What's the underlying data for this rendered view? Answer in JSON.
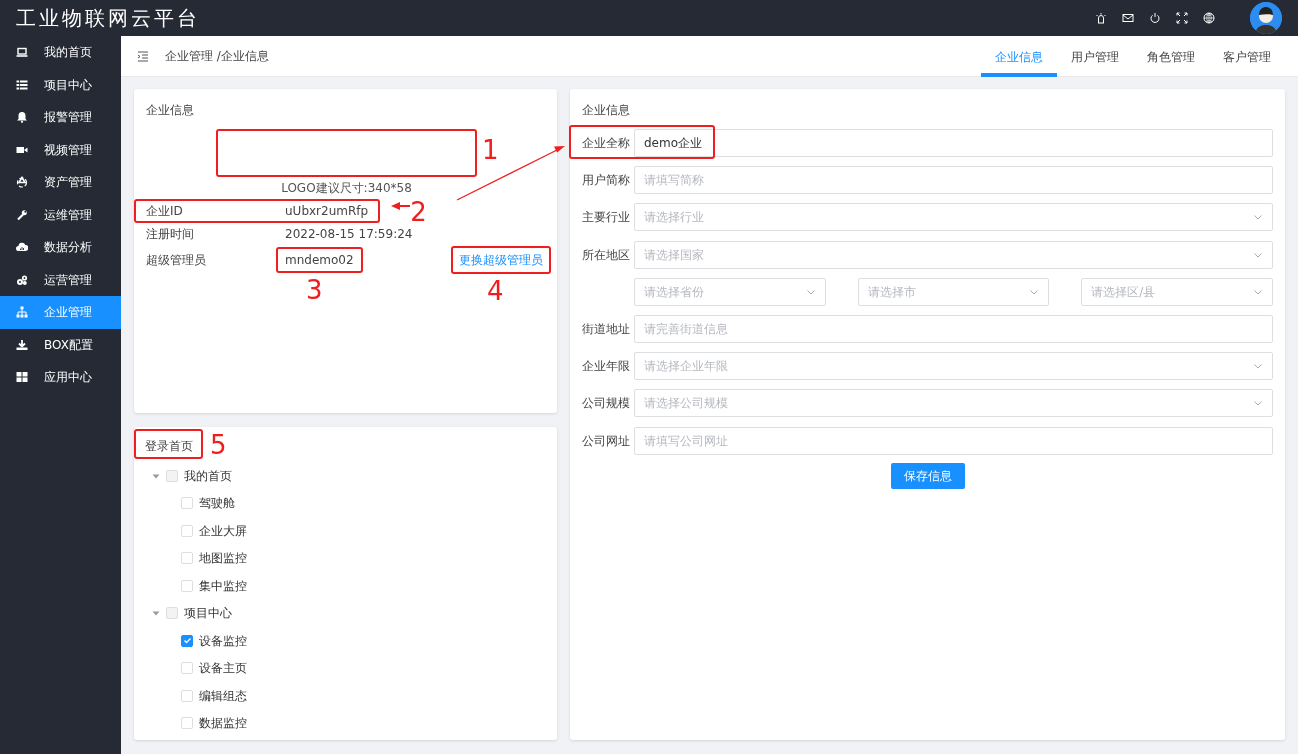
{
  "app_title": "工业物联网云平台",
  "sidebar": {
    "items": [
      {
        "label": "我的首页",
        "selected": false
      },
      {
        "label": "项目中心",
        "selected": false
      },
      {
        "label": "报警管理",
        "selected": false
      },
      {
        "label": "视频管理",
        "selected": false
      },
      {
        "label": "资产管理",
        "selected": false
      },
      {
        "label": "运维管理",
        "selected": false
      },
      {
        "label": "数据分析",
        "selected": false
      },
      {
        "label": "运营管理",
        "selected": false
      },
      {
        "label": "企业管理",
        "selected": true
      },
      {
        "label": "BOX配置",
        "selected": false
      },
      {
        "label": "应用中心",
        "selected": false
      }
    ]
  },
  "breadcrumb": "企业管理 /企业信息",
  "tabs": [
    {
      "label": "企业信息",
      "selected": true
    },
    {
      "label": "用户管理",
      "selected": false
    },
    {
      "label": "角色管理",
      "selected": false
    },
    {
      "label": "客户管理",
      "selected": false
    }
  ],
  "company_card": {
    "title": "企业信息",
    "logo_annotation": "1",
    "logo_hint": "LOGO建议尺寸:340*58",
    "details": [
      {
        "label": "企业ID",
        "value": "uUbxr2umRfp",
        "annotation": "2"
      },
      {
        "label": "注册时间",
        "value": "2022-08-15 17:59:24"
      },
      {
        "label": "超级管理员",
        "value": "mndemo02",
        "value_annotation": "3"
      }
    ],
    "change_admin_link": "更换超级管理员",
    "link_annotation": "4"
  },
  "login_home": {
    "title": "登录首页",
    "title_annotation": "5",
    "tree": [
      {
        "label": "我的首页",
        "expanded": true,
        "checked": false,
        "disabled": true,
        "children": [
          {
            "label": "驾驶舱",
            "checked": false
          },
          {
            "label": "企业大屏",
            "checked": false
          },
          {
            "label": "地图监控",
            "checked": false
          },
          {
            "label": "集中监控",
            "checked": false
          }
        ]
      },
      {
        "label": "项目中心",
        "expanded": true,
        "checked": false,
        "disabled": true,
        "children": [
          {
            "label": "设备监控",
            "checked": true
          },
          {
            "label": "设备主页",
            "checked": false
          },
          {
            "label": "编辑组态",
            "checked": false
          },
          {
            "label": "数据监控",
            "checked": false
          }
        ]
      }
    ]
  },
  "form": {
    "title": "企业信息",
    "fields": [
      {
        "label": "企业全称",
        "kind": "input",
        "value": "demo企业",
        "highlighted": true
      },
      {
        "label": "用户简称",
        "kind": "input",
        "placeholder": "请填写简称"
      },
      {
        "label": "主要行业",
        "kind": "select",
        "placeholder": "请选择行业"
      },
      {
        "label": "所在地区",
        "kind": "select",
        "placeholder": "请选择国家",
        "sub_selects": [
          {
            "placeholder": "请选择省份"
          },
          {
            "placeholder": "请选择市"
          },
          {
            "placeholder": "请选择区/县"
          }
        ]
      },
      {
        "label": "街道地址",
        "kind": "input",
        "placeholder": "请完善街道信息"
      },
      {
        "label": "企业年限",
        "kind": "select",
        "placeholder": "请选择企业年限"
      },
      {
        "label": "公司规模",
        "kind": "select",
        "placeholder": "请选择公司规模"
      },
      {
        "label": "公司网址",
        "kind": "input",
        "placeholder": "请填写公司网址"
      }
    ],
    "save_button": "保存信息"
  }
}
